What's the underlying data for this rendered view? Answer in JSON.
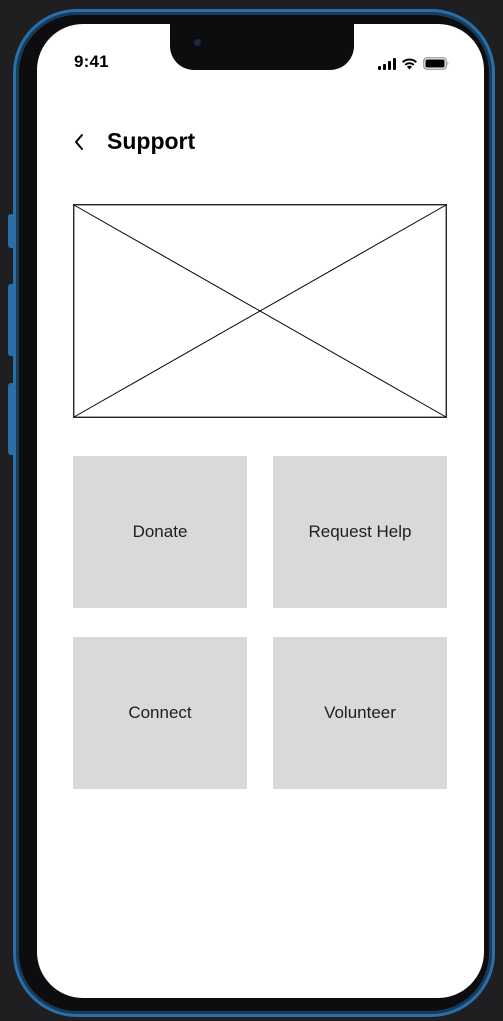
{
  "status_bar": {
    "time": "9:41",
    "icons": [
      "signal-icon",
      "wifi-icon",
      "battery-icon"
    ]
  },
  "header": {
    "back_icon": "chevron-left-icon",
    "title": "Support"
  },
  "hero": {
    "type": "image-placeholder"
  },
  "actions": [
    {
      "label": "Donate"
    },
    {
      "label": "Request Help"
    },
    {
      "label": "Connect"
    },
    {
      "label": "Volunteer"
    }
  ],
  "colors": {
    "background": "#1f1f21",
    "frame_accent": "#2a6fa8",
    "screen": "#ffffff",
    "tile": "#d9d9d9",
    "text": "#000000"
  }
}
